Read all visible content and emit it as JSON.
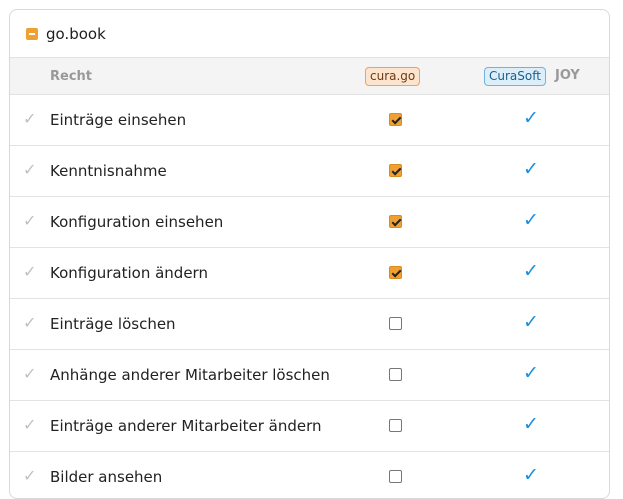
{
  "panel": {
    "title": "go.book",
    "collapse_icon": "minus-square-icon",
    "accent": "#f0a030"
  },
  "columns": {
    "right_label": "Recht",
    "cura_badge": "cura.go",
    "curasoft_badge": "CuraSoft",
    "joy_label": "JOY"
  },
  "rows": [
    {
      "label": "Einträge einsehen",
      "cura": true,
      "curasoft": true
    },
    {
      "label": "Kenntnisnahme",
      "cura": true,
      "curasoft": true
    },
    {
      "label": "Konfiguration einsehen",
      "cura": true,
      "curasoft": true
    },
    {
      "label": "Konfiguration ändern",
      "cura": true,
      "curasoft": true
    },
    {
      "label": "Einträge löschen",
      "cura": false,
      "curasoft": true
    },
    {
      "label": "Anhänge anderer Mitarbeiter löschen",
      "cura": false,
      "curasoft": true
    },
    {
      "label": "Einträge anderer Mitarbeiter ändern",
      "cura": false,
      "curasoft": true
    },
    {
      "label": "Bilder ansehen",
      "cura": false,
      "curasoft": true
    }
  ],
  "icons": {
    "row_check": "✓",
    "granted_check": "✓"
  }
}
